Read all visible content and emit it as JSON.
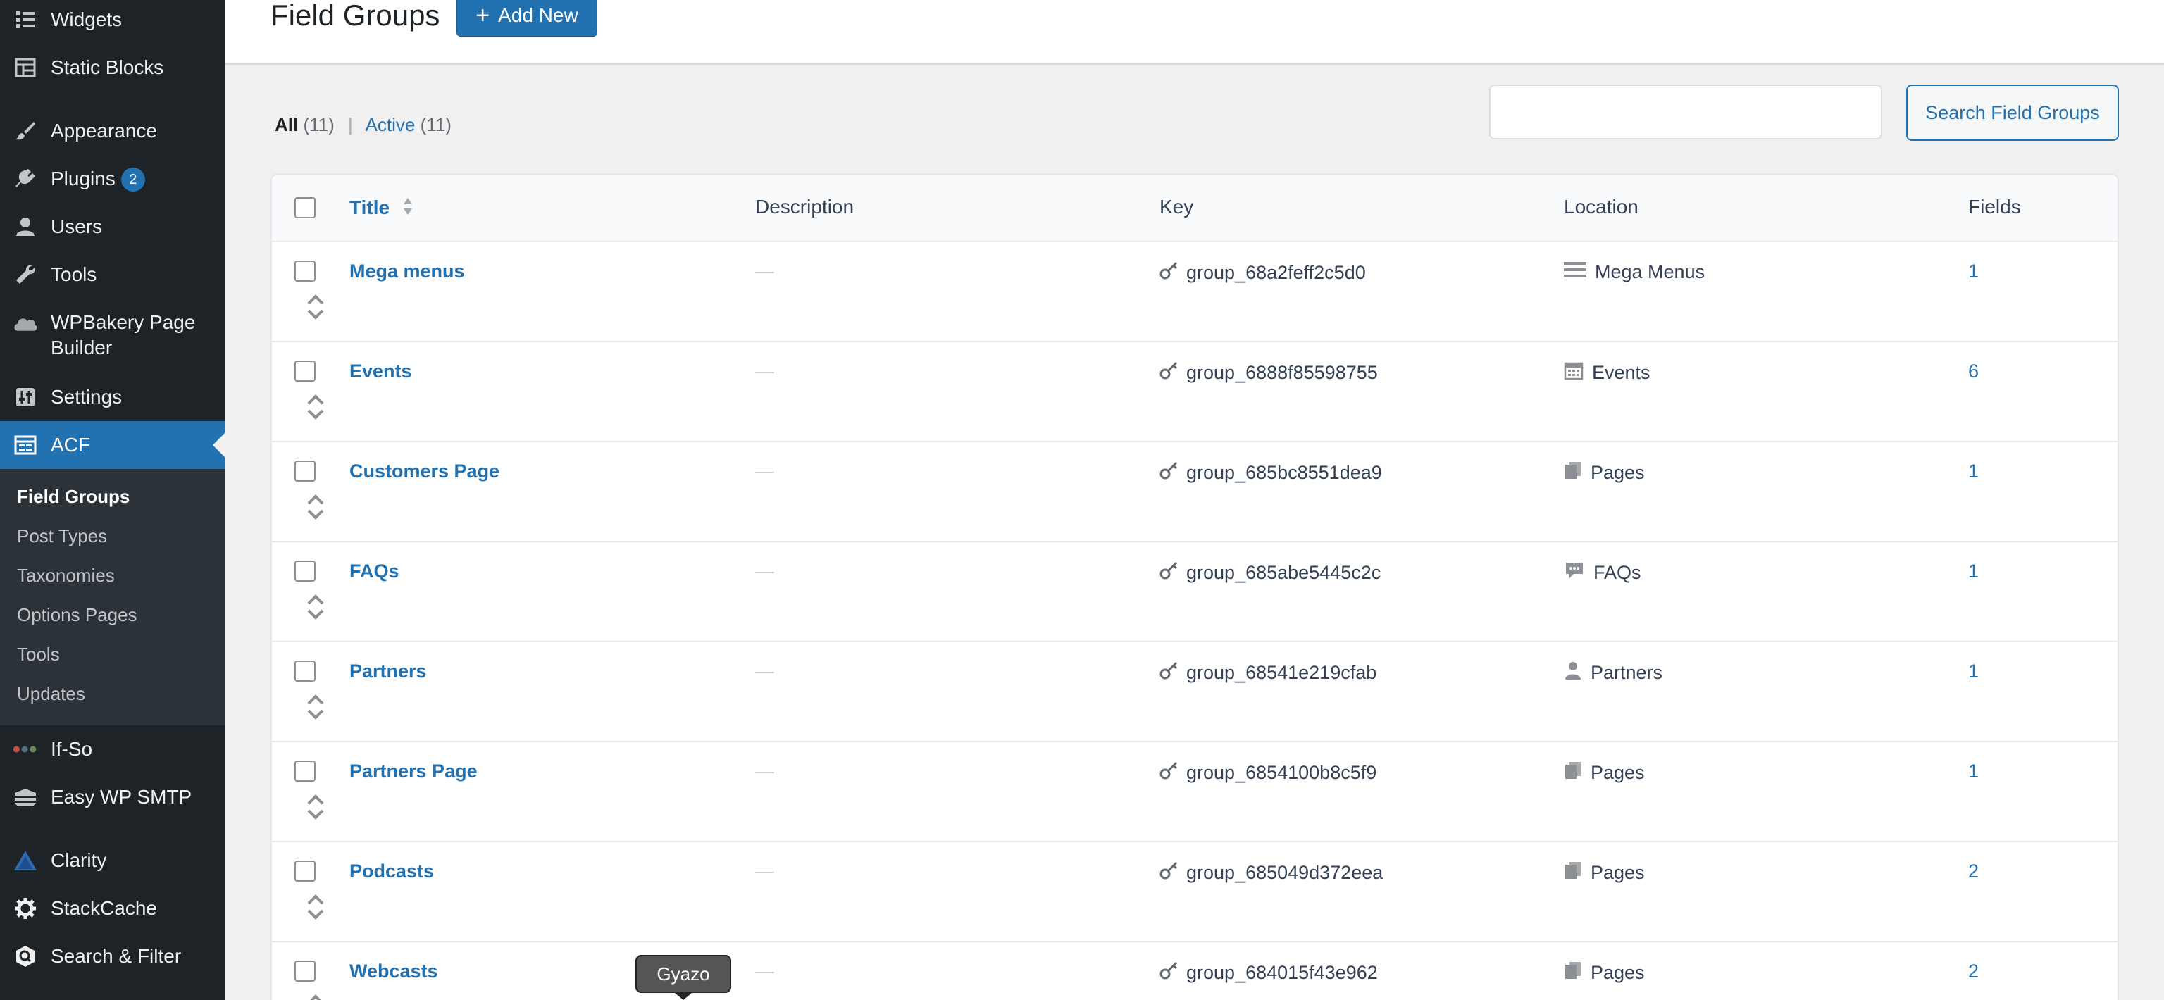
{
  "sidebar": {
    "items": [
      {
        "label": "Widgets",
        "icon": "widgets-icon"
      },
      {
        "label": "Static Blocks",
        "icon": "blocks-icon"
      },
      {
        "label": "Appearance",
        "icon": "brush-icon"
      },
      {
        "label": "Plugins",
        "icon": "plugin-icon",
        "badge": "2"
      },
      {
        "label": "Users",
        "icon": "user-icon"
      },
      {
        "label": "Tools",
        "icon": "wrench-icon"
      },
      {
        "label": "WPBakery Page Builder",
        "icon": "cloud-icon"
      },
      {
        "label": "Settings",
        "icon": "settings-icon"
      },
      {
        "label": "ACF",
        "icon": "acf-icon"
      },
      {
        "label": "If-So",
        "icon": "dots-icon"
      },
      {
        "label": "Easy WP SMTP",
        "icon": "mail-icon"
      },
      {
        "label": "Clarity",
        "icon": "clarity-icon"
      },
      {
        "label": "StackCache",
        "icon": "gear-icon"
      },
      {
        "label": "Search & Filter",
        "icon": "search-filter-icon"
      }
    ],
    "submenu": [
      {
        "label": "Field Groups",
        "current": true
      },
      {
        "label": "Post Types"
      },
      {
        "label": "Taxonomies"
      },
      {
        "label": "Options Pages"
      },
      {
        "label": "Tools"
      },
      {
        "label": "Updates"
      }
    ]
  },
  "header": {
    "title": "Field Groups",
    "add_new_label": "Add New"
  },
  "filters": {
    "all_label": "All",
    "all_count": "(11)",
    "separator": "|",
    "active_label": "Active",
    "active_count": "(11)"
  },
  "search": {
    "button_label": "Search Field Groups",
    "value": ""
  },
  "table": {
    "columns": [
      "Title",
      "Description",
      "Key",
      "Location",
      "Fields"
    ],
    "rows": [
      {
        "title": "Mega menus",
        "description": "—",
        "key": "group_68a2feff2c5d0",
        "location": "Mega Menus",
        "location_icon": "menu-icon",
        "fields": "1"
      },
      {
        "title": "Events",
        "description": "—",
        "key": "group_6888f85598755",
        "location": "Events",
        "location_icon": "calendar-icon",
        "fields": "6"
      },
      {
        "title": "Customers Page",
        "description": "—",
        "key": "group_685bc8551dea9",
        "location": "Pages",
        "location_icon": "pages-icon",
        "fields": "1"
      },
      {
        "title": "FAQs",
        "description": "—",
        "key": "group_685abe5445c2c",
        "location": "FAQs",
        "location_icon": "chat-icon",
        "fields": "1"
      },
      {
        "title": "Partners",
        "description": "—",
        "key": "group_68541e219cfab",
        "location": "Partners",
        "location_icon": "person-icon",
        "fields": "1"
      },
      {
        "title": "Partners Page",
        "description": "—",
        "key": "group_6854100b8c5f9",
        "location": "Pages",
        "location_icon": "pages-icon",
        "fields": "1"
      },
      {
        "title": "Podcasts",
        "description": "—",
        "key": "group_685049d372eea",
        "location": "Pages",
        "location_icon": "pages-icon",
        "fields": "2"
      },
      {
        "title": "Webcasts",
        "description": "—",
        "key": "group_684015f43e962",
        "location": "Pages",
        "location_icon": "pages-icon",
        "fields": "2"
      }
    ]
  },
  "tooltip": {
    "label": "Gyazo"
  }
}
